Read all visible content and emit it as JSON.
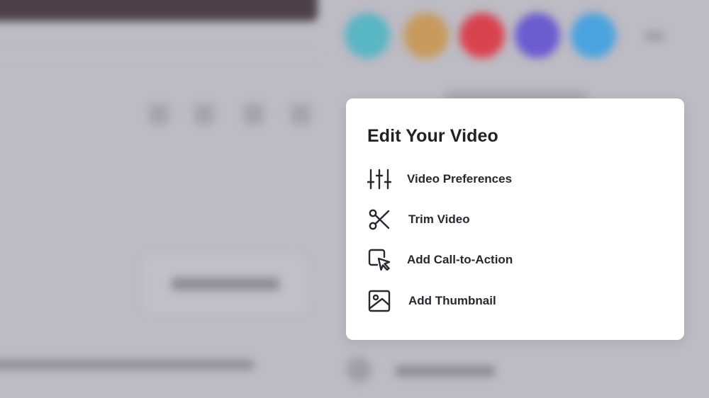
{
  "popup": {
    "title": "Edit Your Video",
    "items": [
      {
        "label": "Video Preferences",
        "icon": "sliders-icon"
      },
      {
        "label": "Trim Video",
        "icon": "scissors-icon"
      },
      {
        "label": "Add Call-to-Action",
        "icon": "cursor-click-icon"
      },
      {
        "label": "Add Thumbnail",
        "icon": "image-icon"
      }
    ]
  },
  "background": {
    "avatars": [
      {
        "icon": "avatar-icon",
        "color": "#59b6c4"
      },
      {
        "icon": "avatar-icon",
        "color": "#c79a5c"
      },
      {
        "icon": "avatar-icon",
        "color": "#d9434e"
      },
      {
        "icon": "avatar-icon",
        "color": "#6b5cd0"
      },
      {
        "icon": "avatar-icon",
        "color": "#4aa3df"
      }
    ]
  },
  "colors": {
    "overlay": "#bdbbc3",
    "card": "#ffffff",
    "title_text": "#232126",
    "item_text": "#2a2730",
    "top_bar": "#4e4048"
  }
}
